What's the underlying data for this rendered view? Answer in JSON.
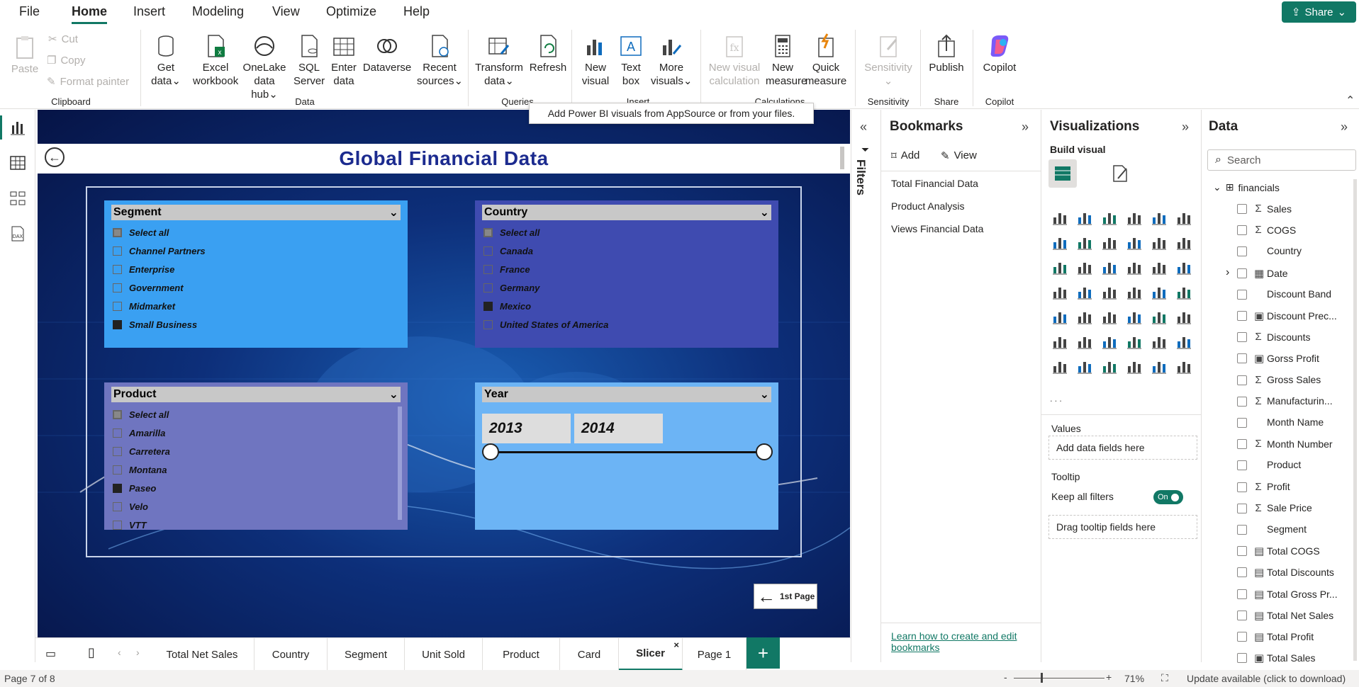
{
  "menu": {
    "items": [
      "File",
      "Home",
      "Insert",
      "Modeling",
      "View",
      "Optimize",
      "Help"
    ],
    "active": "Home",
    "share": "Share"
  },
  "ribbon": {
    "clipboard": {
      "paste": "Paste",
      "cut": "Cut",
      "copy": "Copy",
      "format_painter": "Format painter",
      "group": "Clipboard"
    },
    "data": {
      "get_data": [
        "Get",
        "data"
      ],
      "excel": [
        "Excel",
        "workbook"
      ],
      "onelake": [
        "OneLake",
        "data hub"
      ],
      "sql": [
        "SQL",
        "Server"
      ],
      "enter": [
        "Enter",
        "data"
      ],
      "dataverse": "Dataverse",
      "recent": [
        "Recent",
        "sources"
      ],
      "group": "Data"
    },
    "queries": {
      "transform": [
        "Transform",
        "data"
      ],
      "refresh": "Refresh",
      "group": "Queries"
    },
    "insert": {
      "new_visual": [
        "New",
        "visual"
      ],
      "text_box": [
        "Text",
        "box"
      ],
      "more_visuals": [
        "More",
        "visuals"
      ],
      "group": "Insert"
    },
    "calculations": {
      "new_visual_calc": [
        "New visual",
        "calculation"
      ],
      "new_measure": [
        "New",
        "measure"
      ],
      "quick_measure": [
        "Quick",
        "measure"
      ],
      "group": "Calculations"
    },
    "sensitivity": {
      "label": "Sensitivity",
      "group": "Sensitivity"
    },
    "share": {
      "publish": "Publish",
      "group": "Share"
    },
    "copilot": {
      "label": "Copilot",
      "group": "Copilot"
    }
  },
  "tooltip": "Add Power BI visuals from AppSource or from your files.",
  "report": {
    "title": "Global Financial Data",
    "page_button": "1st Page",
    "slicers": {
      "segment": {
        "title": "Segment",
        "items": [
          {
            "label": "Select all",
            "state": "partial"
          },
          {
            "label": "Channel Partners",
            "state": "off"
          },
          {
            "label": "Enterprise",
            "state": "off"
          },
          {
            "label": "Government",
            "state": "off"
          },
          {
            "label": "Midmarket",
            "state": "off"
          },
          {
            "label": "Small Business",
            "state": "on"
          }
        ]
      },
      "country": {
        "title": "Country",
        "items": [
          {
            "label": "Select all",
            "state": "partial"
          },
          {
            "label": "Canada",
            "state": "off"
          },
          {
            "label": "France",
            "state": "off"
          },
          {
            "label": "Germany",
            "state": "off"
          },
          {
            "label": "Mexico",
            "state": "on"
          },
          {
            "label": "United States of America",
            "state": "off"
          }
        ]
      },
      "product": {
        "title": "Product",
        "items": [
          {
            "label": "Select all",
            "state": "partial"
          },
          {
            "label": "Amarilla",
            "state": "off"
          },
          {
            "label": "Carretera",
            "state": "off"
          },
          {
            "label": "Montana",
            "state": "off"
          },
          {
            "label": "Paseo",
            "state": "on"
          },
          {
            "label": "Velo",
            "state": "off"
          },
          {
            "label": "VTT",
            "state": "off"
          }
        ]
      },
      "year": {
        "title": "Year",
        "start": "2013",
        "end": "2014"
      }
    }
  },
  "filters_label": "Filters",
  "bookmarks": {
    "title": "Bookmarks",
    "add": "Add",
    "view": "View",
    "items": [
      "Total Financial Data",
      "Product Analysis",
      "Views Financial Data"
    ],
    "learn_link": "Learn how to create and edit bookmarks"
  },
  "visualizations": {
    "title": "Visualizations",
    "build_visual": "Build visual",
    "more": "...",
    "values_label": "Values",
    "values_placeholder": "Add data fields here",
    "tooltip_label": "Tooltip",
    "keep_filters": "Keep all filters",
    "toggle": "On",
    "tooltip_placeholder": "Drag tooltip fields here"
  },
  "data_pane": {
    "title": "Data",
    "search_placeholder": "Search",
    "table": "financials",
    "fields": [
      {
        "name": "Sales",
        "type": "sum"
      },
      {
        "name": "COGS",
        "type": "sum"
      },
      {
        "name": "Country",
        "type": "text"
      },
      {
        "name": "Date",
        "type": "date"
      },
      {
        "name": "Discount Band",
        "type": "text"
      },
      {
        "name": "Discount Prec...",
        "type": "calc"
      },
      {
        "name": "Discounts",
        "type": "sum"
      },
      {
        "name": "Gorss Profit",
        "type": "calc"
      },
      {
        "name": "Gross Sales",
        "type": "sum"
      },
      {
        "name": "Manufacturin...",
        "type": "sum"
      },
      {
        "name": "Month Name",
        "type": "text"
      },
      {
        "name": "Month Number",
        "type": "sum"
      },
      {
        "name": "Product",
        "type": "text"
      },
      {
        "name": "Profit",
        "type": "sum"
      },
      {
        "name": "Sale Price",
        "type": "sum"
      },
      {
        "name": "Segment",
        "type": "text"
      },
      {
        "name": "Total COGS",
        "type": "measure"
      },
      {
        "name": "Total Discounts",
        "type": "measure"
      },
      {
        "name": "Total Gross Pr...",
        "type": "measure"
      },
      {
        "name": "Total Net Sales",
        "type": "measure"
      },
      {
        "name": "Total Profit",
        "type": "measure"
      },
      {
        "name": "Total Sales",
        "type": "calc"
      }
    ]
  },
  "tabs": [
    "Total Net Sales",
    "Country",
    "Segment",
    "Unit Sold",
    "Product",
    "Card",
    "Slicer",
    "Page 1"
  ],
  "active_tab": "Slicer",
  "status": {
    "page": "Page 7 of 8",
    "zoom": "71%",
    "update": "Update available (click to download)"
  },
  "colors": {
    "accent": "#117865",
    "title": "#1c2b8f",
    "segment_bg": "#3aa0f2",
    "country_bg": "#3f4bb0",
    "product_bg": "#6f75c0",
    "year_bg": "#6cb4f5"
  }
}
